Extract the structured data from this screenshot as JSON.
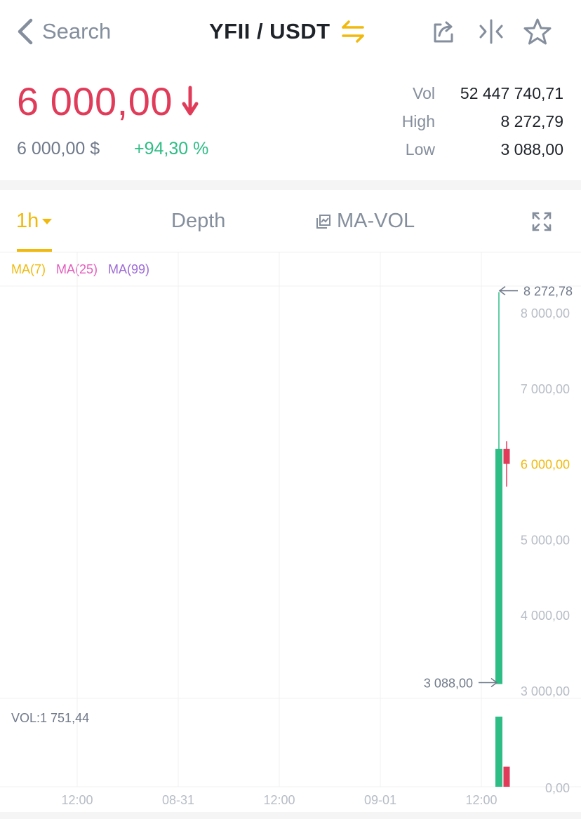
{
  "header": {
    "back_label": "Search",
    "pair": "YFII / USDT",
    "colors": {
      "swap": "#f0b90b",
      "icon": "#848e9c"
    },
    "icons": [
      "share-icon",
      "compare-icon",
      "star-icon"
    ]
  },
  "ticker": {
    "last_price": "6 000,00",
    "direction": "down",
    "fiat_price": "6 000,00 $",
    "change": "+94,30 %",
    "stats": [
      {
        "label": "Vol",
        "value": "52 447 740,71"
      },
      {
        "label": "High",
        "value": "8 272,79"
      },
      {
        "label": "Low",
        "value": "3 088,00"
      }
    ],
    "colors": {
      "down": "#e03c5a",
      "up": "#2ebd85"
    }
  },
  "tabs": {
    "interval": "1h",
    "depth": "Depth",
    "indicator": "MA-VOL"
  },
  "indicators": {
    "ma7": "MA(7)",
    "ma25": "MA(25)",
    "ma99": "MA(99)",
    "colors": {
      "ma7": "#f0b90b",
      "ma25": "#e35bbd",
      "ma99": "#9c6ad6"
    }
  },
  "chart_data": {
    "type": "candlestick",
    "y_ticks": [
      "8 000,00",
      "7 000,00",
      "6 000,00",
      "5 000,00",
      "4 000,00",
      "3 000,00"
    ],
    "y_tick_values": [
      8000,
      7000,
      6000,
      5000,
      4000,
      3000
    ],
    "ylim": [
      3000,
      8300
    ],
    "current_price_value": 6000,
    "x_ticks": [
      "12:00",
      "08-31",
      "12:00",
      "09-01",
      "12:00"
    ],
    "high_marker": {
      "label": "8 272,78",
      "value": 8272.78
    },
    "low_marker": {
      "label": "3 088,00",
      "value": 3088.0
    },
    "candles": [
      {
        "open": 3088.0,
        "close": 6200.0,
        "high": 8272.78,
        "low": 3088.0,
        "color": "up"
      },
      {
        "open": 6200.0,
        "close": 6000.0,
        "high": 6300.0,
        "low": 5700.0,
        "color": "down"
      }
    ],
    "volume_label": "VOL:1 751,44",
    "volume_axis_label": "0,00",
    "volume_bars": [
      {
        "value": 1751.44,
        "color": "up"
      },
      {
        "value": 500.0,
        "color": "down"
      }
    ],
    "colors": {
      "up": "#2ebd85",
      "down": "#e03c5a",
      "grid": "#f0f0f0",
      "axis": "#b7bdc6",
      "current": "#f0b90b"
    }
  }
}
